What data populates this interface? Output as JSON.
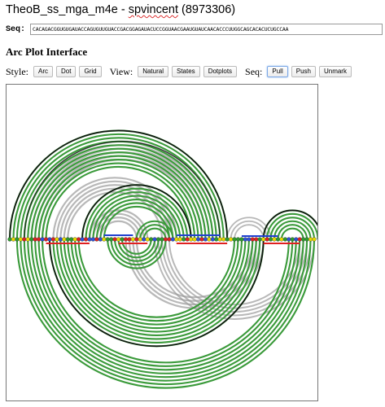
{
  "page": {
    "title_prefix": "TheoB_ss_mga_m4e - ",
    "title_user": "spvincent",
    "title_suffix": " (8973306)"
  },
  "sequence": {
    "label": "Seq:",
    "value": "CACAGACGGUGUGAUACCAGUGUUGUACCGACGGAGAUACUCCGGUAACGAAUGUAUCAACACCCUUGGCAGCACACUCUGCCAA"
  },
  "section": {
    "heading": "Arc Plot Interface"
  },
  "toolbar": {
    "style_label": "Style:",
    "style_buttons": [
      "Arc",
      "Dot",
      "Grid"
    ],
    "view_label": "View:",
    "view_buttons": [
      "Natural",
      "States",
      "Dotplots"
    ],
    "seq_label": "Seq:",
    "seq_buttons": [
      "Pull",
      "Push",
      "Unmark"
    ],
    "active_button": "Pull"
  },
  "plot": {
    "colors": {
      "pair_green": "#3a9a3a",
      "pair_gray": "#9a9a9a",
      "pair_black": "#111111",
      "highlight_red": "#e02020",
      "highlight_blue": "#2040d0",
      "base_A": "#e8d800",
      "base_C": "#2e9a2e",
      "base_G": "#dd2222",
      "base_U": "#2f52d8"
    }
  }
}
